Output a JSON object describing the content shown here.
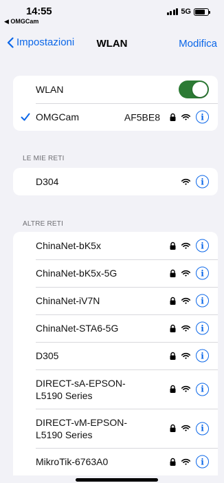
{
  "status_bar": {
    "time": "14:55",
    "back_app": "◀ OMGCam",
    "network": "5G",
    "battery_level": 0.8
  },
  "nav": {
    "back_label": "Impostazioni",
    "title": "WLAN",
    "action_label": "Modifica"
  },
  "wlan_group": {
    "toggle_label": "WLAN",
    "toggle_on": true,
    "connected_network": {
      "name": "OMGCam",
      "bssid": "AF5BE8",
      "secured": true
    }
  },
  "my_networks": {
    "header": "LE MIE RETI",
    "items": [
      {
        "name": "D304",
        "secured": false
      }
    ]
  },
  "other_networks": {
    "header": "ALTRE RETI",
    "items": [
      {
        "name": "ChinaNet-bK5x",
        "secured": true
      },
      {
        "name": "ChinaNet-bK5x-5G",
        "secured": true
      },
      {
        "name": "ChinaNet-iV7N",
        "secured": true
      },
      {
        "name": "ChinaNet-STA6-5G",
        "secured": true
      },
      {
        "name": "D305",
        "secured": true
      },
      {
        "name": "DIRECT-sA-EPSON-",
        "name2": "L5190 Series",
        "secured": true
      },
      {
        "name": "DIRECT-vM-EPSON-",
        "name2": "L5190 Series",
        "secured": true
      },
      {
        "name": "MikroTik-6763A0",
        "secured": true
      }
    ]
  },
  "colors": {
    "accent": "#0a66e8",
    "toggle_on": "#2c7a34",
    "background": "#f2f2f7"
  },
  "icons": [
    "chevron-left-icon",
    "checkmark-icon",
    "lock-icon",
    "wifi-icon",
    "info-icon",
    "signal-icon",
    "battery-icon"
  ]
}
